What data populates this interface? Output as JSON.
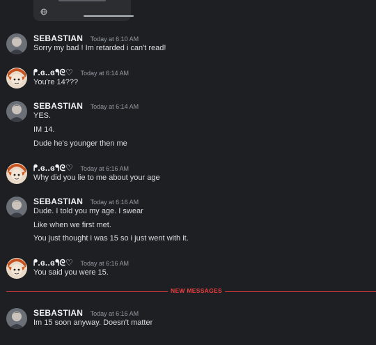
{
  "divider": {
    "label": "NEW MESSAGES"
  },
  "users": {
    "sebastian": "SEBASTIAN",
    "other": "ʕ̢̣̣̣̣̩̩̩̩·͡˔·ོɁ̡̣̣̣̣̩̩̩̩✧"
  },
  "groups": [
    {
      "user": "SEBASTIAN",
      "time": "Today at 6:10 AM",
      "lines": [
        "Sorry my bad ! Im retarded i can't read!"
      ]
    },
    {
      "user": "ᖰ.ɞ..ɞᖳᘓ♡",
      "time": "Today at 6:14 AM",
      "lines": [
        "You're 14???"
      ]
    },
    {
      "user": "SEBASTIAN",
      "time": "Today at 6:14 AM",
      "lines": [
        "YES.",
        "IM 14.",
        "Dude he's younger then me"
      ]
    },
    {
      "user": "ᖰ.ɞ..ɞᖳᘓ♡",
      "time": "Today at 6:16 AM",
      "lines": [
        "Why did you lie to me about your age"
      ]
    },
    {
      "user": "SEBASTIAN",
      "time": "Today at 6:16 AM",
      "lines": [
        "Dude. I told you my age. I swear",
        "Like when we first met.",
        "You just thought i was 15 so i just went with it."
      ]
    },
    {
      "user": "ᖰ.ɞ..ɞᖳᘓ♡",
      "time": "Today at 6:16 AM",
      "lines": [
        "You said you were 15."
      ]
    },
    {
      "user": "SEBASTIAN",
      "time": "Today at 6:16 AM",
      "lines": [
        "Im 15 soon anyway. Doesn't matter"
      ]
    }
  ]
}
